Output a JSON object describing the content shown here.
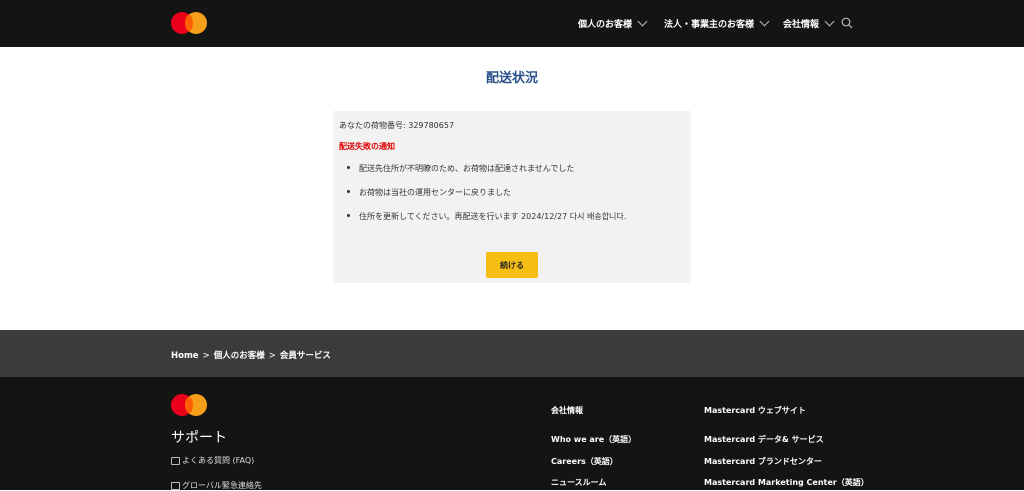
{
  "header": {
    "nav": [
      {
        "label": "個人のお客様"
      },
      {
        "label": "法人・事業主のお客様"
      },
      {
        "label": "会社情報"
      }
    ]
  },
  "main": {
    "title": "配送状況",
    "tracking_text": "あなたの荷物番号: 329780657",
    "notice_title": "配送失敗の通知",
    "bullets": [
      "配送先住所が不明瞭のため、お荷物は配達されませんでした",
      "お荷物は当社の運用センターに戻りました",
      "住所を更新してください。再配送を行います 2024/12/27 다시 배송합니다."
    ],
    "continue_label": "続ける"
  },
  "breadcrumb": {
    "items": [
      "Home",
      "個人のお客様",
      "会員サービス"
    ],
    "separator": ">"
  },
  "footer": {
    "support_title": "サポート",
    "support_links": [
      "よくある質問 (FAQ)",
      "グローバル緊急連絡先"
    ],
    "company_heading": "会社情報",
    "company_links": [
      "Who we are（英語）",
      "Careers（英語）",
      "ニュースルーム"
    ],
    "mastercard_heading": "Mastercard ウェブサイト",
    "mastercard_links": [
      "Mastercard データ& サービス",
      "Mastercard ブランドセンター",
      "Mastercard Marketing Center（英語）"
    ]
  },
  "colors": {
    "header_bg": "#141413",
    "title": "#2a4f8a",
    "notice": "#e00000",
    "button": "#f4bf12",
    "breadcrumb_bg": "#3b3b3b"
  }
}
